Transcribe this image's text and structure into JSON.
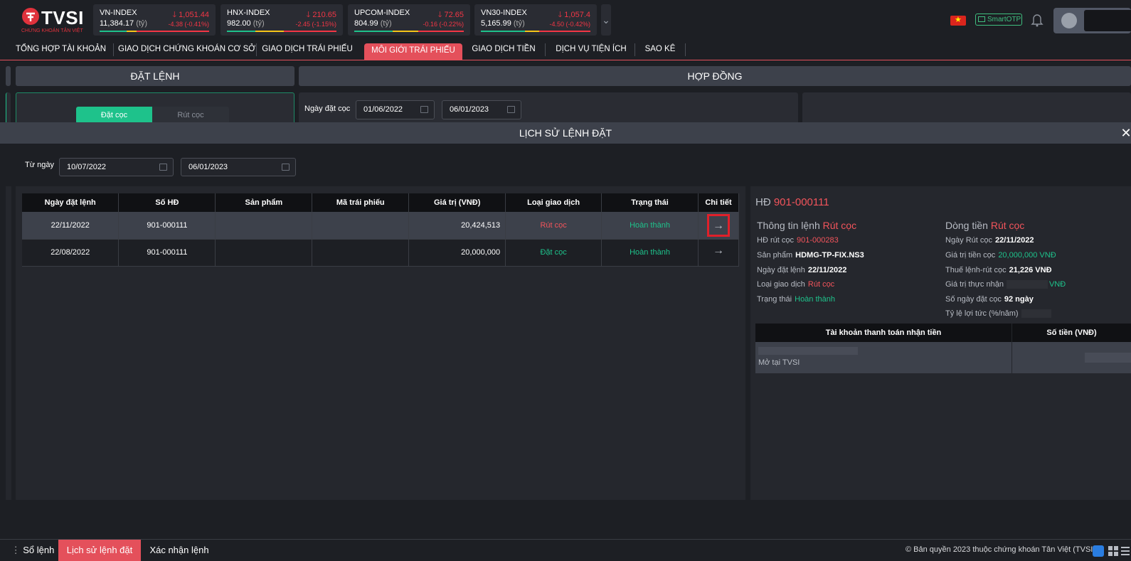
{
  "logo": {
    "brand": "TVSI",
    "tagline": "CHỨNG KHOÁN TÂN VIỆT"
  },
  "indices": [
    {
      "name": "VN-INDEX",
      "price": "1,051.44",
      "volume": "11,384.17",
      "unit": "(tỷ)",
      "change": "-4.38",
      "pct": "(-0.41%)"
    },
    {
      "name": "HNX-INDEX",
      "price": "210.65",
      "volume": "982.00",
      "unit": "(tỷ)",
      "change": "-2.45",
      "pct": "(-1.15%)"
    },
    {
      "name": "UPCOM-INDEX",
      "price": "72.65",
      "volume": "804.99",
      "unit": "(tỷ)",
      "change": "-0.16",
      "pct": "(-0.22%)"
    },
    {
      "name": "VN30-INDEX",
      "price": "1,057.4",
      "volume": "5,165.99",
      "unit": "(tỷ)",
      "change": "-4.50",
      "pct": "(-0.42%)"
    }
  ],
  "header": {
    "otp_label": "SmartOTP"
  },
  "nav": [
    "TỔNG HỢP TÀI KHOẢN",
    "GIAO DỊCH CHỨNG KHOÁN CƠ SỞ",
    "GIAO DỊCH TRÁI PHIẾU",
    "MÔI GIỚI TRÁI PHIẾU",
    "GIAO DỊCH TIỀN",
    "DỊCH VỤ TIỆN ÍCH",
    "SAO KÊ"
  ],
  "background": {
    "order_tab": "ĐẶT LỆNH",
    "contract_tab": "HỢP ĐỒNG",
    "deposit_btn": "Đặt cọc",
    "withdraw_btn": "Rút cọc",
    "deposit_date_label": "Ngày đặt cọc",
    "deposit_from": "01/06/2022",
    "deposit_to": "06/01/2023"
  },
  "modal": {
    "title": "LỊCH SỬ LỆNH ĐẶT",
    "close": "✕",
    "from_label": "Từ ngày",
    "from_date": "10/07/2022",
    "to_date": "06/01/2023"
  },
  "table": {
    "headers": [
      "Ngày đặt lệnh",
      "Số HĐ",
      "Sản phẩm",
      "Mã trái phiếu",
      "Giá trị (VNĐ)",
      "Loại giao dịch",
      "Trạng thái",
      "Chi tiết"
    ],
    "rows": [
      {
        "date": "22/11/2022",
        "contract": "901-000111",
        "product": "",
        "bond": "",
        "value": "20,424,513",
        "type": "Rút cọc",
        "status": "Hoàn thành"
      },
      {
        "date": "22/08/2022",
        "contract": "901-000111",
        "product": "",
        "bond": "",
        "value": "20,000,000",
        "type": "Đặt cọc",
        "status": "Hoàn thành"
      }
    ]
  },
  "detail": {
    "title_label": "HĐ",
    "title_value": "901-000111",
    "order_info_label": "Thông tin lệnh",
    "order_info_value": "Rút cọc",
    "cashflow_label": "Dòng tiền",
    "cashflow_value": "Rút cọc",
    "left": [
      {
        "label": "HĐ rút cọc",
        "value": "901-000283"
      },
      {
        "label": "Sản phẩm",
        "value": "HDMG-TP-FIX.NS3"
      },
      {
        "label": "Ngày đặt lệnh",
        "value": "22/11/2022"
      },
      {
        "label": "Loại giao dịch",
        "value": "Rút cọc"
      },
      {
        "label": "Trạng thái",
        "value": "Hoàn thành"
      }
    ],
    "right": [
      {
        "label": "Ngày Rút cọc",
        "value": "22/11/2022"
      },
      {
        "label": "Giá trị tiền cọc",
        "value": "20,000,000 VNĐ"
      },
      {
        "label": "Thuế lệnh-rút cọc",
        "value": "21,226 VNĐ"
      },
      {
        "label": "Giá trị thực nhận",
        "value": "VNĐ"
      },
      {
        "label": "Số ngày đặt cọc",
        "value": "92 ngày"
      },
      {
        "label": "Tỷ lệ lợi tức (%/năm)",
        "value": ""
      }
    ],
    "account_headers": [
      "Tài khoản thanh toán nhận tiền",
      "Số tiền (VNĐ)"
    ],
    "account_note": "Mở tại TVSI"
  },
  "footer": {
    "tabs": [
      "Sổ lệnh",
      "Lịch sử lệnh đặt",
      "Xác nhận lệnh"
    ],
    "copyright": "© Bản quyền 2023 thuộc chứng khoán Tân Việt (TVSI)"
  }
}
